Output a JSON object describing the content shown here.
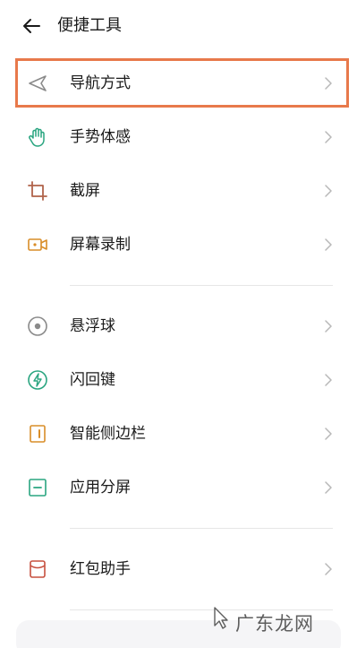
{
  "header": {
    "title": "便捷工具"
  },
  "section1": [
    {
      "label": "导航方式"
    },
    {
      "label": "手势体感"
    },
    {
      "label": "截屏"
    },
    {
      "label": "屏幕录制"
    }
  ],
  "section2": [
    {
      "label": "悬浮球"
    },
    {
      "label": "闪回键"
    },
    {
      "label": "智能侧边栏"
    },
    {
      "label": "应用分屏"
    }
  ],
  "section3": [
    {
      "label": "红包助手"
    }
  ],
  "watermark": {
    "text": "广东龙网"
  },
  "colors": {
    "highlight": "#e8794b",
    "nav_icon": "#8a8a8a",
    "green": "#2aa580",
    "brown": "#b0634a",
    "orange": "#d98d28",
    "red": "#c7503f",
    "chevron": "#b8b8b8"
  }
}
